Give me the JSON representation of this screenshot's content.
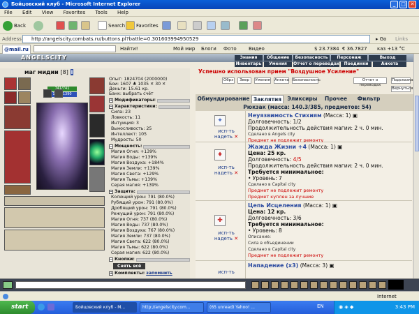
{
  "window": {
    "title": "Бойцовский клуб - Microsoft Internet Explorer"
  },
  "menu": [
    "File",
    "Edit",
    "View",
    "Favorites",
    "Tools",
    "Help"
  ],
  "toolbar": {
    "back": "Back",
    "search": "Search",
    "favorites": "Favorites"
  },
  "address": {
    "label": "Address",
    "url": "http://angelscity.combats.ru/buttons.pl?battle=0.301603994950529",
    "go": "Go",
    "links": "Links"
  },
  "linksbar": {
    "mail": "@mail.ru",
    "find": "Найти!",
    "mymir": "Мой мир",
    "blogs": "Блоги",
    "photo": "Фото",
    "video": "Видео",
    "usd": "$ 23.7384",
    "eur": "€ 36.7827",
    "weather": "каз +13 °C"
  },
  "game": {
    "logo": "ANGELSCITY",
    "topnav_row1": [
      "Знания",
      "Общение",
      "Безопасность",
      "Персонаж",
      "Выход"
    ],
    "topnav_row2": [
      "Инвентарь",
      "Умения",
      "Отчет о переводах",
      "Поединки",
      "Анкета"
    ],
    "char": {
      "name": "маг мидии",
      "level": "[8]",
      "hp": "741/741",
      "mp": "1390/1390"
    },
    "stats": {
      "exp": "Опыт: 1824704 (2000000)",
      "fights": "Бои: 1607 ♣ 1035 ✕ 30 ✕",
      "money": "Деньги: 15.61 кр.",
      "bank": "Банк: выбрать счёт",
      "modifiers_title": "Модификаторы:",
      "chars_title": "Характеристики:",
      "chars": [
        "Сила: 23",
        "Ловкость: 11",
        "Интуиция: 3",
        "Выносливость: 25",
        "Интеллект: 105",
        "Мудрость: 50"
      ],
      "power_title": "Мощность:",
      "power": [
        "Магия Огня: +139%",
        "Магия Воды: +139%",
        "Магия Воздуха: +184%",
        "Магия Земли: +139%",
        "Магия Света: +129%",
        "Магия Тьмы: +139%",
        "Серая магия: +139%"
      ],
      "defense_title": "Защита:",
      "defense": [
        "Колющий урон: 791 (80.0%)",
        "Рубящий урон: 791 (80.0%)",
        "Дробящий урон: 791 (80.0%)",
        "Режущий урон: 791 (80.0%)",
        "Магия Огня: 737 (80.0%)",
        "Магия Воды: 737 (80.0%)",
        "Магия Воздуха: 767 (80.0%)",
        "Магия Земли: 737 (80.0%)",
        "Магия Света: 622 (80.0%)",
        "Магия Тьмы: 622 (80.0%)",
        "Серая магия: 622 (80.0%)"
      ],
      "buttons_title": "Кнопки:",
      "remove_all": "Снять всё",
      "sets_title": "Комплекты:",
      "remember": "запомнить"
    },
    "notice": "Успешно использован прием \"Воздушное Усиление\"",
    "action_buttons": [
      "Обрз",
      "Звер",
      "Умения",
      "Анкета",
      "Безопасность",
      "Отчет о переводах",
      "Подсказка",
      "Вернуться"
    ],
    "tabs": [
      "Обмундирование",
      "Заклятия",
      "Эликсиры",
      "Прочее",
      "Фильтр"
    ],
    "active_tab": 1,
    "bag": "Рюкзак (масса: 140.3/385, предметов: 54)",
    "use_label": "исп-ть",
    "drop_label": "надеть",
    "items": [
      {
        "name": "Неуязвимость Стихиям",
        "mass": "(Масса: 1)",
        "lines": [
          "Долговечность: 1/2",
          "Продолжительность действия магии: 2 ч. 0 мин.",
          "Сделано в Angels city"
        ],
        "warn": "Предмет не подлежит ремонту"
      },
      {
        "name": "Жажда Жизни +4",
        "mass": "(Масса: 1)",
        "lines": [
          "Цена: 25 кр.",
          "Долговечность: 4/5",
          "Продолжительность действия магии: 2 ч. 0 мин.",
          "Требуется минимальное:",
          "• Уровень: 7",
          "Сделано в Capital city"
        ],
        "warn": "Предмет не подлежит ремонту",
        "warn2": "Предмет куплен за лучшие"
      },
      {
        "name": "Цепь Исцеления",
        "mass": "(Масса: 1)",
        "lines": [
          "Цена: 12 кр.",
          "Долговечность: 3/6",
          "Требуется минимальное:",
          "• Уровень: 8",
          "Описание:",
          "Сила в объединении",
          "Сделано в Capital city"
        ],
        "warn": "Предмет не подлежит ремонту"
      },
      {
        "name": "Нападение (x3)",
        "mass": "(Масса: 3)",
        "lines": [],
        "warn": ""
      }
    ]
  },
  "statusbar": "Internet",
  "taskbar": {
    "start": "start",
    "tasks": [
      "Бойцовский клуб - M...",
      "http://angelscity.com...",
      "(65 unread) Yahoo! ..."
    ],
    "lang": "EN",
    "time": "3:43 PM"
  }
}
